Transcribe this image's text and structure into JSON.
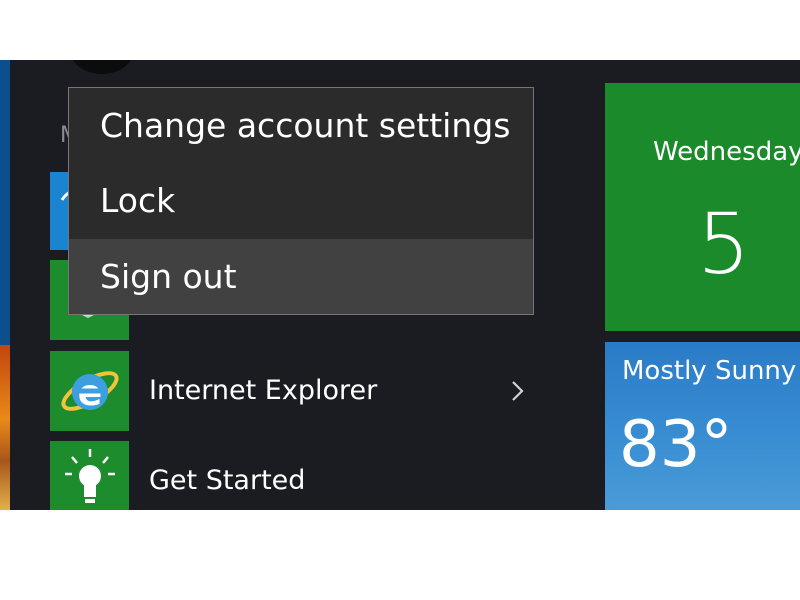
{
  "start_menu": {
    "section_letter": "M",
    "apps": [
      {
        "label": "",
        "icon": "app-tile-icon"
      },
      {
        "label": "",
        "icon": "app-tile-icon"
      },
      {
        "label": "Internet Explorer",
        "icon": "internet-explorer-icon",
        "has_submenu": true
      },
      {
        "label": "Get Started",
        "icon": "lightbulb-icon",
        "has_submenu": false
      }
    ]
  },
  "context_menu": {
    "items": [
      {
        "label": "Change account settings"
      },
      {
        "label": "Lock"
      },
      {
        "label": "Sign out",
        "highlighted": true
      }
    ]
  },
  "tiles": {
    "calendar": {
      "day": "Wednesday",
      "date": "5"
    },
    "weather": {
      "condition": "Mostly Sunny",
      "temperature": "83°"
    }
  },
  "colors": {
    "start_background": "#1a1c21",
    "tile_green": "#1d8c2c",
    "tile_blue": "#1a84d0",
    "menu_background": "#2b2b2b",
    "menu_highlight": "#414141",
    "menu_border": "#767676"
  }
}
